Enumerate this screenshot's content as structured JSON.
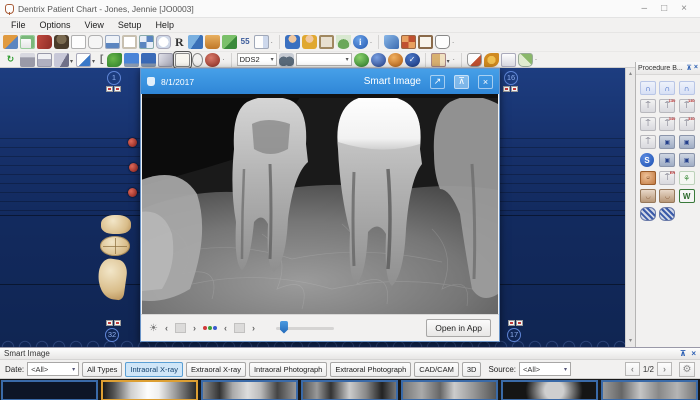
{
  "window": {
    "title": "Dentrix Patient Chart - Jones, Jennie [JO0003]"
  },
  "icons": {
    "minimize": "–",
    "maximize": "□",
    "close": "×",
    "dropdown": "▾",
    "prev": "‹",
    "next": "›",
    "brightness": "☀",
    "settings": "⚙",
    "expand": "↗",
    "pin": "⊼",
    "refresh": "↻",
    "check": "✓",
    "info": "i",
    "rx": "R",
    "quick_letters": "55",
    "bridge": "∩",
    "implant": "⍑",
    "monitor": "▣",
    "s_button": "S",
    "word": "W",
    "hatch": "▨",
    "scroll_up": "▴",
    "scroll_down": "▾"
  },
  "menu": {
    "items": [
      "File",
      "Options",
      "View",
      "Setup",
      "Help"
    ]
  },
  "toolbar": {
    "provider": "DDS2",
    "view_value": ""
  },
  "chart": {
    "teeth": {
      "top_left": "1",
      "top_right": "16",
      "bottom_left": "32",
      "bottom_right": "17"
    }
  },
  "dialog": {
    "date": "8/1/2017",
    "title": "Smart Image",
    "open_in_app": "Open in App"
  },
  "procedure_panel": {
    "title": "Procedure B...",
    "codes": {
      "c130": "130",
      "c140": "140",
      "c340": "340",
      "er": "ER"
    }
  },
  "bottom_panel": {
    "title": "Smart Image",
    "date_label": "Date:",
    "date_value": "<All>",
    "filters": [
      "All Types",
      "Intraoral X-ray",
      "Extraoral X-ray",
      "Intraoral Photograph",
      "Extraoral Photograph",
      "CAD/CAM",
      "3D"
    ],
    "selected_filter": "Intraoral X-ray",
    "source_label": "Source:",
    "source_value": "<All>",
    "page": "1/2"
  },
  "colors": {
    "dialog_header": "#2f86d7",
    "chart_bg": "#16306a",
    "selected_filter_bg": "#cfe6f8",
    "thumb_border": "#3a6aa8",
    "selected_thumb_border": "#dd9f33"
  }
}
